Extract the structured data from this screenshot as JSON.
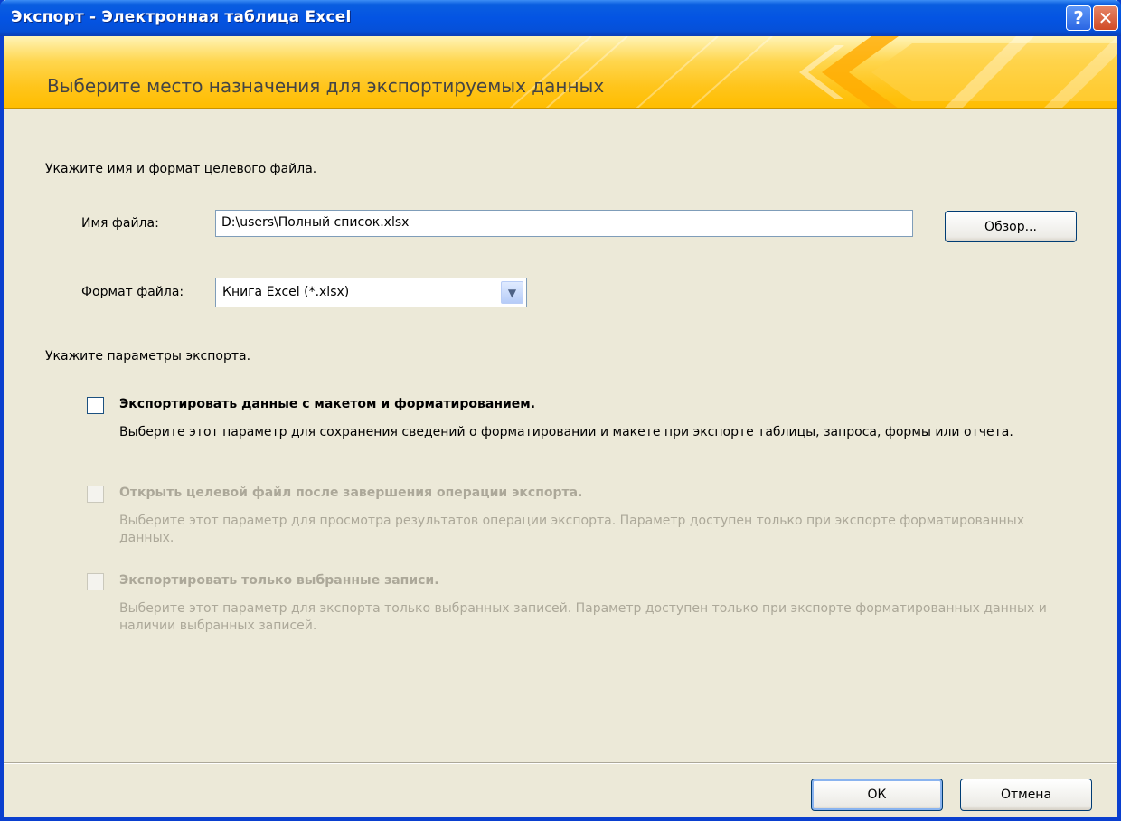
{
  "window": {
    "title": "Экспорт - Электронная таблица Excel",
    "help_glyph": "?",
    "close_glyph": "✕"
  },
  "banner": {
    "heading": "Выберите место назначения для экспортируемых данных"
  },
  "file_section": {
    "intro": "Укажите имя и формат целевого файла.",
    "name_label": "Имя файла:",
    "name_value": "D:\\users\\Полный список.xlsx",
    "browse_button": "Обзор...",
    "format_label": "Формат файла:",
    "format_value": "Книга Excel (*.xlsx)"
  },
  "export_options": {
    "intro": "Укажите параметры экспорта.",
    "options": [
      {
        "title": "Экспортировать данные с макетом и форматированием.",
        "description": "Выберите этот параметр для сохранения сведений о форматировании и макете при экспорте таблицы, запроса, формы или отчета.",
        "checked": false,
        "enabled": true
      },
      {
        "title": "Открыть целевой файл после завершения операции экспорта.",
        "description": "Выберите этот параметр для просмотра результатов операции экспорта. Параметр доступен только при экспорте форматированных данных.",
        "checked": false,
        "enabled": false
      },
      {
        "title": "Экспортировать только выбранные записи.",
        "description": "Выберите этот параметр для экспорта только выбранных записей. Параметр доступен только при экспорте форматированных данных и наличии выбранных записей.",
        "checked": false,
        "enabled": false
      }
    ]
  },
  "footer": {
    "ok_button": "ОК",
    "cancel_button": "Отмена"
  },
  "colors": {
    "titlebar": "#0454e3",
    "banner": "#ffc51c",
    "dialog_bg": "#ece9d8",
    "disabled_text": "#aca899"
  }
}
